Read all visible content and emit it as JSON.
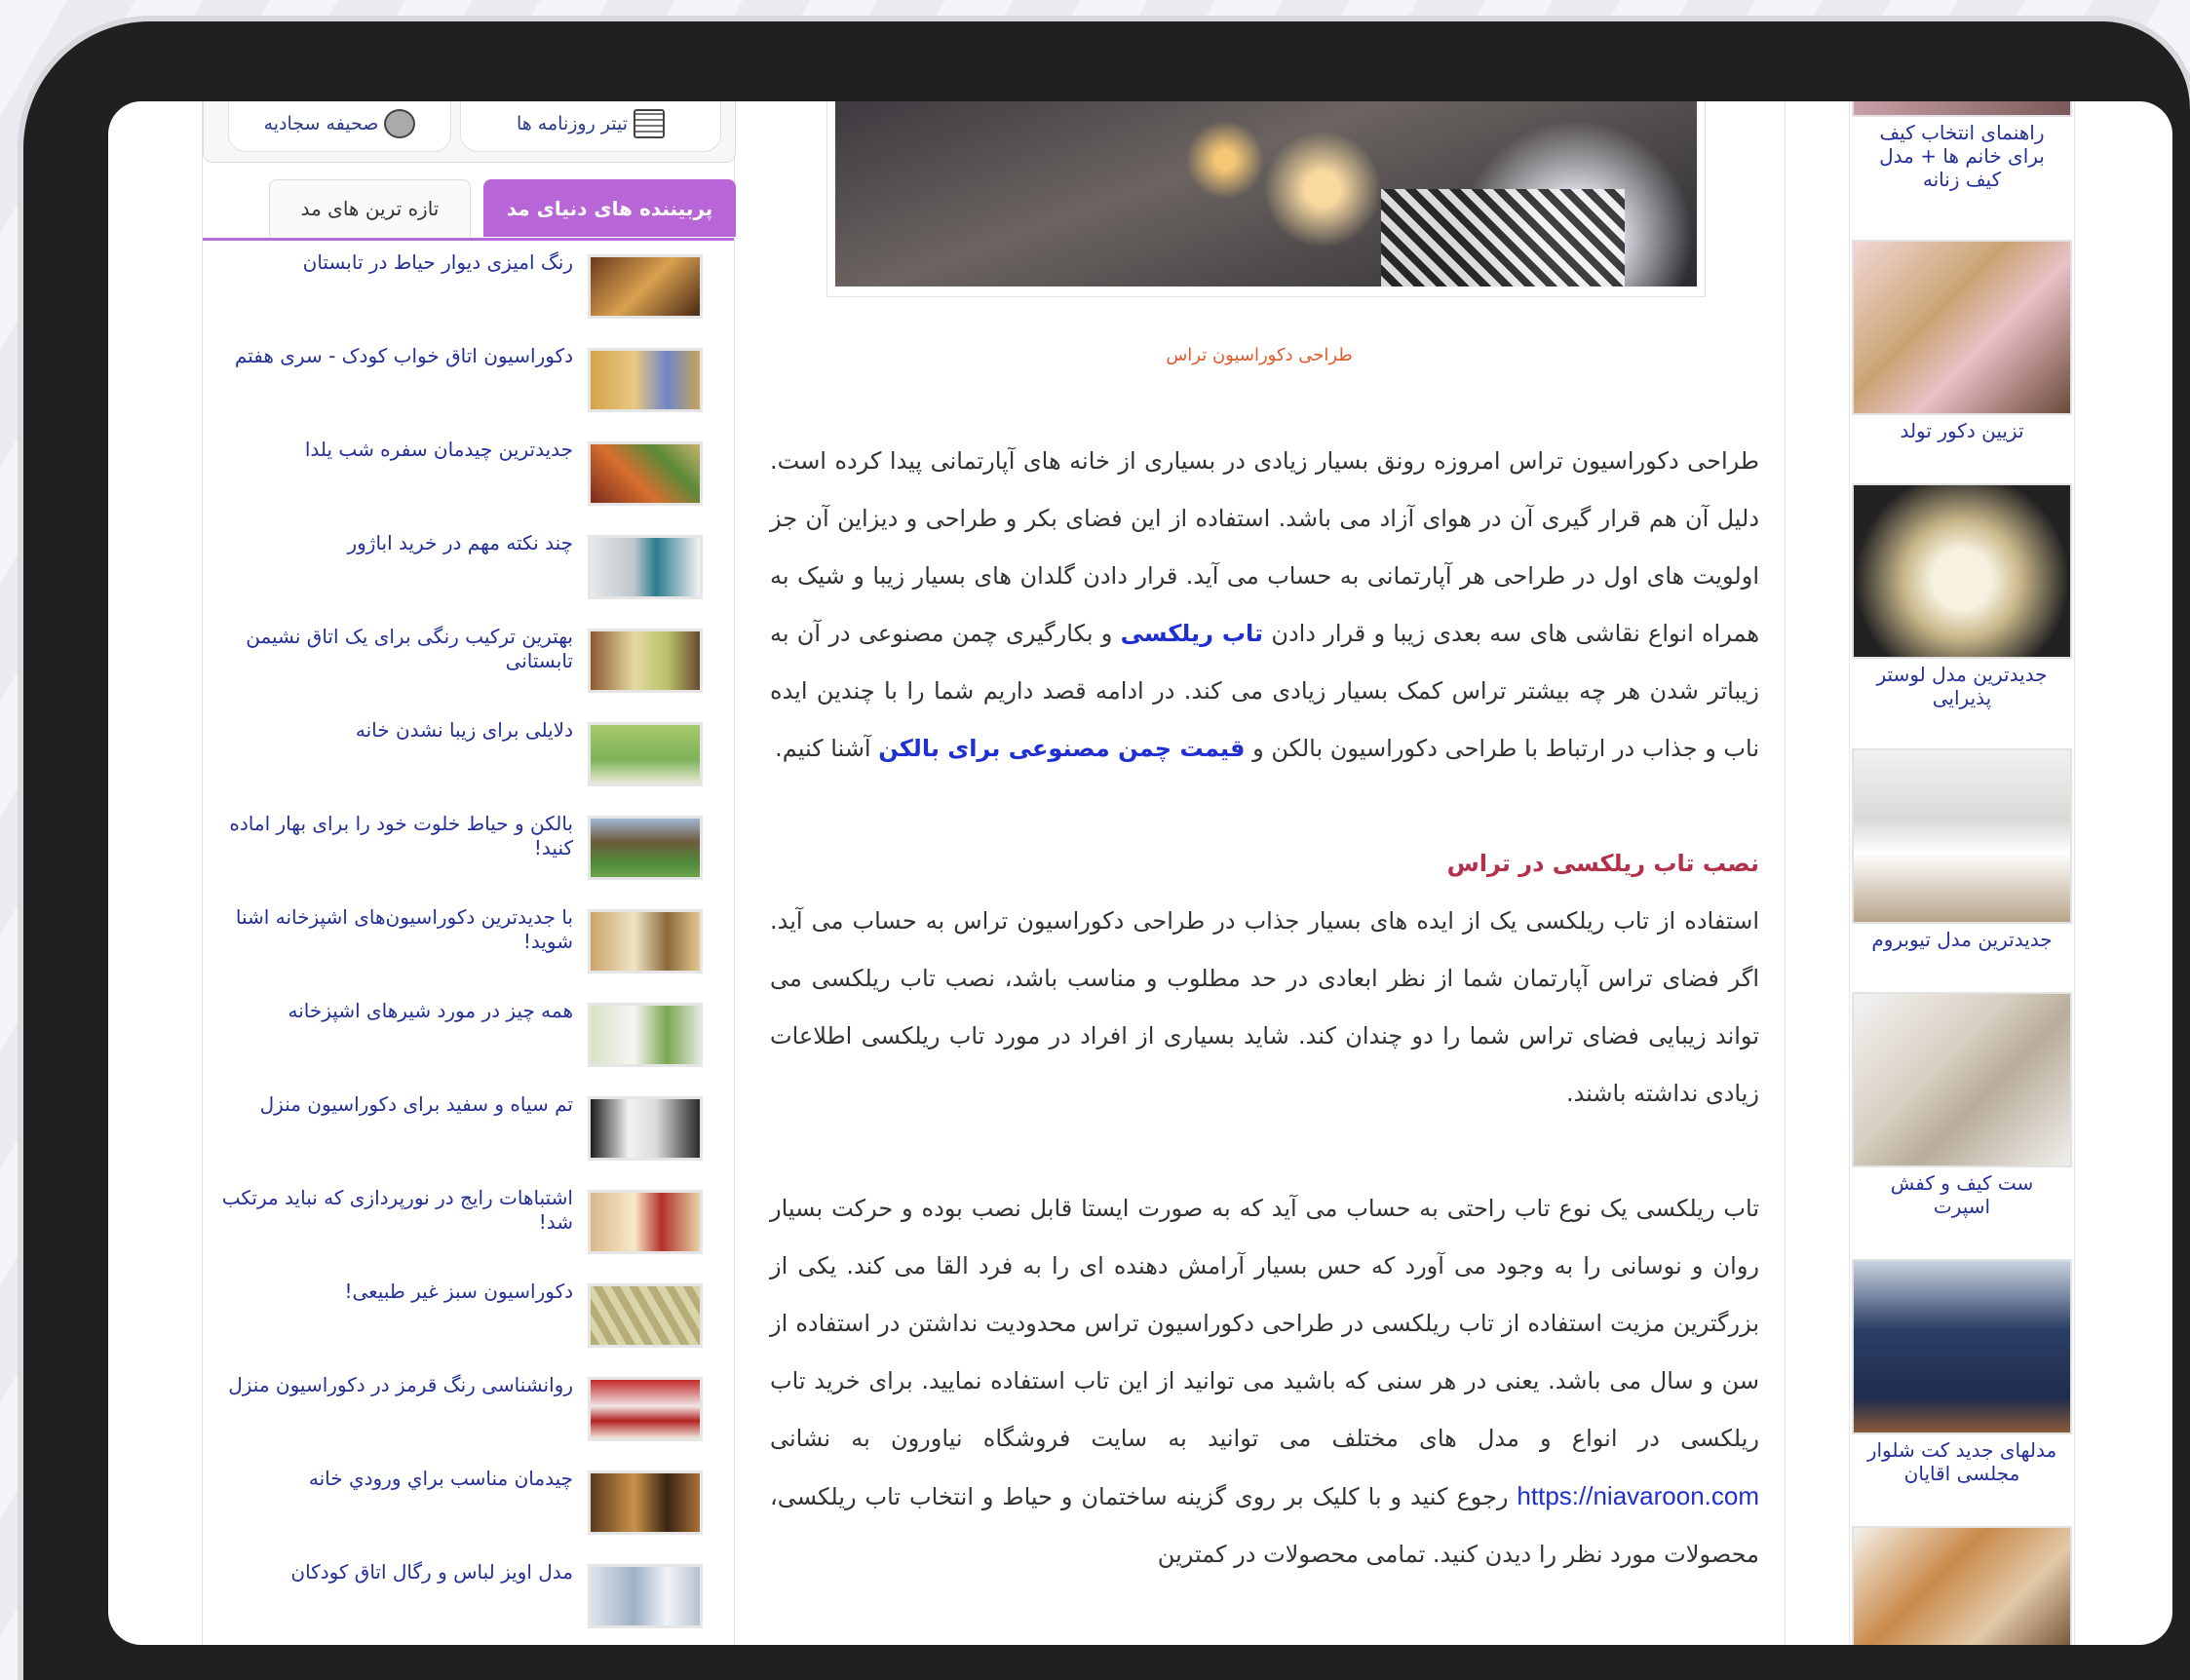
{
  "top_links": {
    "headlines": "تیتر روزنامه ها",
    "sahifeh": "صحیفه سجادیه"
  },
  "tabs": {
    "active": "پربیننده های دنیای مد",
    "inactive": "تازه ترین های مد"
  },
  "news": [
    {
      "title": "رنگ امیزی دیوار حیاط در تابستان"
    },
    {
      "title": "دکوراسیون اتاق خواب کودک - سری هفتم"
    },
    {
      "title": "جدیدترین چیدمان سفره شب یلدا"
    },
    {
      "title": "چند نکته مهم در خرید اباژور"
    },
    {
      "title": "بهترین ترکیب رنگی برای یک اتاق نشیمن تابستانی"
    },
    {
      "title": "دلایلی برای زیبا نشدن خانه"
    },
    {
      "title": "بالکن و حیاط خلوت خود را برای بهار اماده کنید!"
    },
    {
      "title": "با جدیدترین دکوراسیون‌های اشپزخانه اشنا شوید!"
    },
    {
      "title": "همه چیز در مورد شیرهای اشپزخانه"
    },
    {
      "title": "تم سیاه و سفید برای دکوراسیون منزل"
    },
    {
      "title": "اشتباهات رایج در نورپردازی که نباید مرتکب شد!"
    },
    {
      "title": "دکوراسیون سبز غیر طبیعی!"
    },
    {
      "title": "روانشناسی رنگ قرمز در دکوراسیون منزل"
    },
    {
      "title": "چیدمان مناسب براي ورودي خانه"
    },
    {
      "title": "مدل اویز لباس و رگال اتاق کودکان"
    }
  ],
  "article": {
    "caption": "طراحی دکوراسیون تراس",
    "p1_a": "طراحی دکوراسیون تراس امروزه رونق بسیار زیادی در بسیاری از خانه های آپارتمانی پیدا کرده است. دلیل آن هم قرار گیری آن در هوای آزاد می باشد. استفاده از این فضای بکر و طراحی و دیزاین آن جز اولویت های اول در طراحی هر آپارتمانی به حساب می آید. قرار دادن گلدان های بسیار زیبا و شیک به همراه انواع نقاشی های سه بعدی زیبا و قرار دادن",
    "kw1": "تاب ریلکسی",
    "p1_b": "و بکارگیری چمن مصنوعی در آن به زیباتر شدن هر چه بیشتر تراس کمک بسیار زیادی می کند. در ادامه قصد داریم شما را با چندین ایده ناب و جذاب در ارتباط با طراحی دکوراسیون بالکن و",
    "kw2": "قیمت چمن مصنوعی برای بالکن",
    "p1_c": "آشنا کنیم.",
    "subheading": "نصب تاب ریلکسی در تراس",
    "p2": "استفاده از تاب ریلکسی یک از ایده های بسیار جذاب در طراحی دکوراسیون تراس به حساب می آید. اگر فضای تراس آپارتمان شما از نظر ابعادی در حد مطلوب و مناسب باشد، نصب تاب ریلکسی می تواند زیبایی فضای تراس شما را دو چندان کند. شاید بسیاری از افراد در مورد تاب ریلکسی اطلاعات زیادی نداشته باشند.",
    "p3_a": "تاب ریلکسی یک نوع تاب راحتی به حساب می آید که به صورت ایستا قابل نصب بوده و حرکت بسیار روان و نوسانی را به وجود می آورد که حس بسیار آرامش دهنده ای را به فرد القا می کند. یکی از بزرگترین مزیت استفاده از تاب ریلکسی در طراحی دکوراسیون تراس محدودیت نداشتن در استفاده از سن و سال می باشد. یعنی در هر سنی که باشید می توانید از این تاب استفاده نمایید. برای خرید تاب ریلکسی در انواع و مدل های مختلف می توانید به سایت فروشگاه نیاورون به نشانی",
    "url": "https://niavaroon.com",
    "p3_b": "رجوع کنید و با کلیک بر روی گزینه ساختمان و حیاط و انتخاب تاب ریلکسی، محصولات مورد نظر را دیدن کنید. تمامی محصولات در کمترین"
  },
  "right_sidebar": [
    {
      "title": "راهنمای انتخاب کیف برای خانم ها + مدل کیف زنانه"
    },
    {
      "title": "تزیین دکور تولد"
    },
    {
      "title": "جدیدترین مدل لوستر پذیرایی"
    },
    {
      "title": "جدیدترین مدل تیوبروم"
    },
    {
      "title": "ست کیف و کفش اسپرت"
    },
    {
      "title": "مدلهای جدید کت شلوار مجلسی اقایان"
    }
  ],
  "colors": {
    "tab_active": "#b865d8",
    "link": "#24309a",
    "keyword": "#1f2fd0",
    "caption": "#e05a2b",
    "subheading": "#b2304a"
  }
}
